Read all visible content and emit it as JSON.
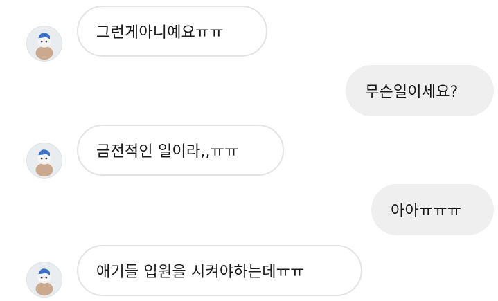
{
  "conversation": {
    "messages": [
      {
        "sender": "other",
        "text": "그런게아니예요ㅠㅠ"
      },
      {
        "sender": "me",
        "text": "무슨일이세요?"
      },
      {
        "sender": "other",
        "text": "금전적인 일이라,,ㅠㅠ"
      },
      {
        "sender": "me",
        "text": "아아ㅠㅠㅠ"
      },
      {
        "sender": "other",
        "text": "애기들 입원을 시켜야하는데ㅠㅠ"
      }
    ]
  },
  "colors": {
    "incoming_bubble_border": "#e3e3e3",
    "outgoing_bubble_bg": "#efefef",
    "text": "#1a1a1a",
    "avatar_accent": "#3a6fc4"
  },
  "icons": {
    "avatar": "user-avatar-icon"
  }
}
